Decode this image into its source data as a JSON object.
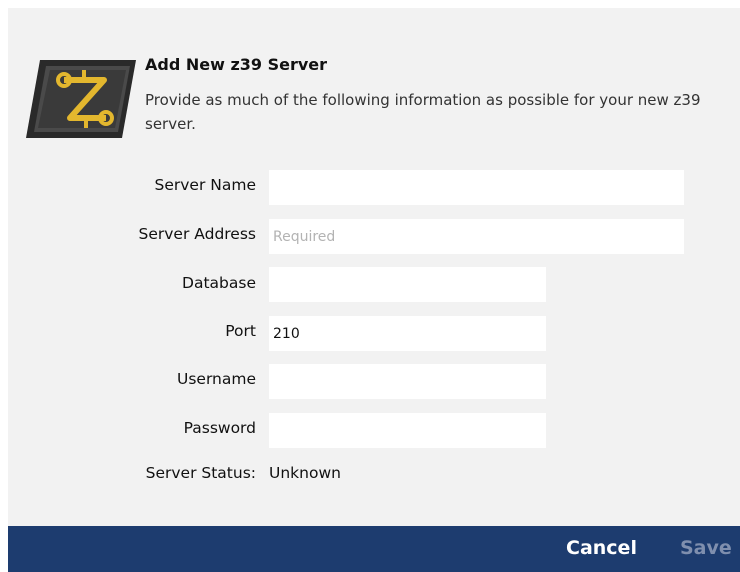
{
  "header": {
    "title": "Add New z39 Server",
    "description": "Provide as much of the following information as possible for your new z39 server."
  },
  "fields": {
    "server_name": {
      "label": "Server Name",
      "value": "",
      "placeholder": ""
    },
    "server_address": {
      "label": "Server Address",
      "value": "",
      "placeholder": "Required"
    },
    "database": {
      "label": "Database",
      "value": "",
      "placeholder": ""
    },
    "port": {
      "label": "Port",
      "value": "210",
      "placeholder": ""
    },
    "username": {
      "label": "Username",
      "value": "",
      "placeholder": ""
    },
    "password": {
      "label": "Password",
      "value": "",
      "placeholder": ""
    }
  },
  "status": {
    "label": "Server Status:",
    "value": "Unknown"
  },
  "footer": {
    "cancel_label": "Cancel",
    "save_label": "Save"
  },
  "icons": {
    "logo": "z39-logo-icon"
  },
  "colors": {
    "background": "#f2f2f2",
    "footer_bar": "#1d3c6f",
    "cancel_text": "#ffffff",
    "save_text_disabled": "#7f8fae",
    "logo_gold": "#e3b72e"
  }
}
